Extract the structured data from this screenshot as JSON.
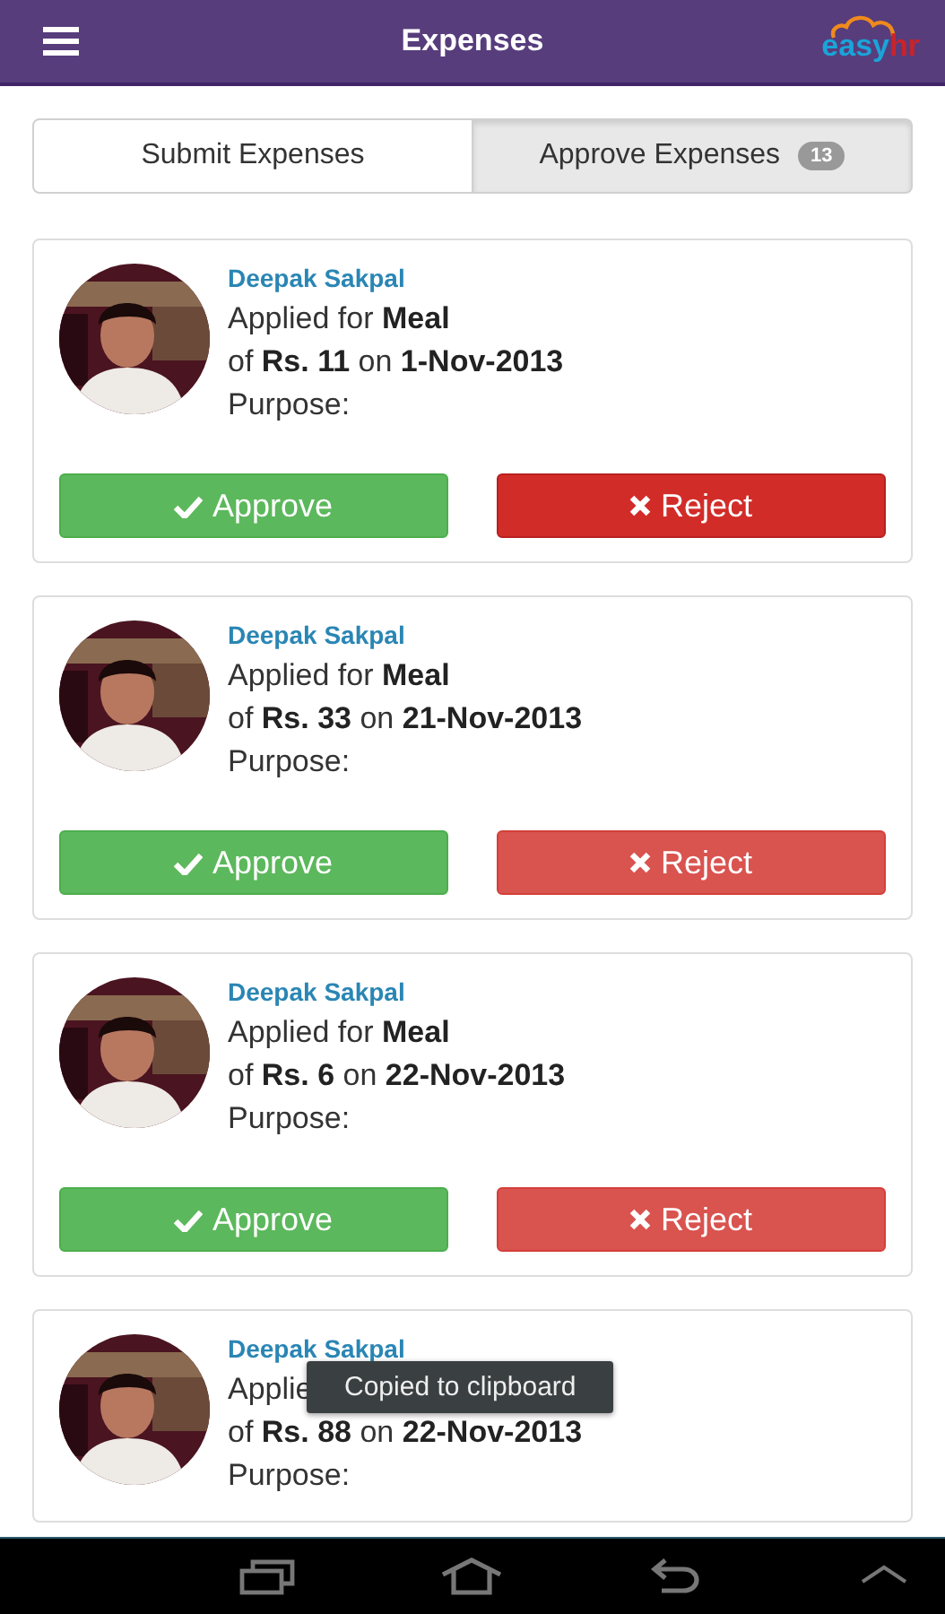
{
  "app_bar": {
    "title": "Expenses",
    "logo": [
      "easy",
      "hr"
    ]
  },
  "tabs": [
    {
      "label": "Submit Expenses",
      "selected": false
    },
    {
      "label": "Approve Expenses",
      "selected": true,
      "badge": "13"
    }
  ],
  "requests": [
    {
      "name": "Deepak Sakpal",
      "lines": [
        "Applied for **Meal**",
        "of **Rs. 11** on **1-Nov-2013**",
        "Purpose:"
      ],
      "actions": [
        {
          "kind": "approve",
          "label": "Approve",
          "pressed": false
        },
        {
          "kind": "reject",
          "label": "Reject",
          "pressed": true
        }
      ]
    },
    {
      "name": "Deepak Sakpal",
      "lines": [
        "Applied for **Meal**",
        "of **Rs. 33** on **21-Nov-2013**",
        "Purpose:"
      ],
      "actions": [
        {
          "kind": "approve",
          "label": "Approve",
          "pressed": false
        },
        {
          "kind": "reject",
          "label": "Reject",
          "pressed": false
        }
      ]
    },
    {
      "name": "Deepak Sakpal",
      "lines": [
        "Applied for **Meal**",
        "of **Rs. 6** on **22-Nov-2013**",
        "Purpose:"
      ],
      "actions": [
        {
          "kind": "approve",
          "label": "Approve",
          "pressed": false
        },
        {
          "kind": "reject",
          "label": "Reject",
          "pressed": false
        }
      ]
    },
    {
      "name": "Deepak Sakpal",
      "lines": [
        "Applie",
        "of **Rs. 88** on **22-Nov-2013**",
        "Purpose:"
      ]
    }
  ],
  "toast": "Copied to clipboard"
}
